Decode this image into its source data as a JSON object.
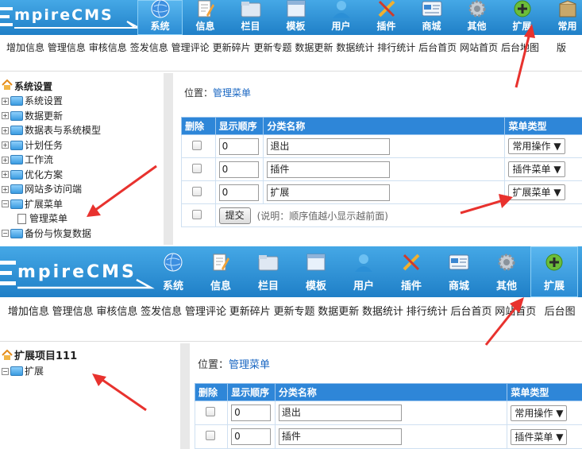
{
  "top": {
    "logo_text": "mpireCMS",
    "logo_letter": "E"
  },
  "shotA": {
    "menu": [
      {
        "label": "系统",
        "icon": "globe-icon",
        "active": true
      },
      {
        "label": "信息",
        "icon": "document-pencil-icon"
      },
      {
        "label": "栏目",
        "icon": "folder-icon"
      },
      {
        "label": "模板",
        "icon": "window-template-icon"
      },
      {
        "label": "用户",
        "icon": "user-icon"
      },
      {
        "label": "插件",
        "icon": "tools-icon"
      },
      {
        "label": "商城",
        "icon": "card-icon"
      },
      {
        "label": "其他",
        "icon": "gear-icon"
      },
      {
        "label": "扩展",
        "icon": "plus-circle-icon"
      },
      {
        "label": "常用",
        "icon": "box-icon"
      }
    ],
    "submenu": [
      "增加信息",
      "管理信息",
      "审核信息",
      "签发信息",
      "管理评论",
      "更新碎片",
      "更新专题",
      "数据更新",
      "数据统计",
      "排行统计",
      "后台首页",
      "网站首页",
      "后台地图",
      "版"
    ],
    "tree": {
      "root": "系统设置",
      "nodes": [
        "系统设置",
        "数据更新",
        "数据表与系统模型",
        "计划任务",
        "工作流",
        "优化方案",
        "网站多访问端",
        "扩展菜单"
      ],
      "child": "管理菜单",
      "after": "备份与恢复数据"
    },
    "location_prefix": "位置：",
    "location_link": "管理菜单",
    "table": {
      "headers": [
        "删除",
        "显示顺序",
        "分类名称",
        "菜单类型"
      ],
      "rows": [
        {
          "order": "0",
          "name": "退出",
          "type": "常用操作"
        },
        {
          "order": "0",
          "name": "插件",
          "type": "插件菜单"
        },
        {
          "order": "0",
          "name": "扩展",
          "type": "扩展菜单"
        }
      ],
      "submit": "提交",
      "note": "(说明：顺序值越小显示越前面)"
    }
  },
  "shotB": {
    "menu": [
      {
        "label": "系统",
        "icon": "globe-icon"
      },
      {
        "label": "信息",
        "icon": "document-pencil-icon"
      },
      {
        "label": "栏目",
        "icon": "folder-icon"
      },
      {
        "label": "模板",
        "icon": "window-template-icon"
      },
      {
        "label": "用户",
        "icon": "user-icon"
      },
      {
        "label": "插件",
        "icon": "tools-icon"
      },
      {
        "label": "商城",
        "icon": "card-icon"
      },
      {
        "label": "其他",
        "icon": "gear-icon"
      },
      {
        "label": "扩展",
        "icon": "plus-circle-icon",
        "active": true
      }
    ],
    "submenu": [
      "增加信息",
      "管理信息",
      "审核信息",
      "签发信息",
      "管理评论",
      "更新碎片",
      "更新专题",
      "数据更新",
      "数据统计",
      "排行统计",
      "后台首页",
      "网站首页",
      "后台图"
    ],
    "tree": {
      "root": "扩展项目111",
      "nodes": [
        "扩展"
      ]
    },
    "location_prefix": "位置：",
    "location_link": "管理菜单",
    "table": {
      "headers": [
        "删除",
        "显示顺序",
        "分类名称",
        "菜单类型"
      ],
      "rows": [
        {
          "order": "0",
          "name": "退出",
          "type": "常用操作"
        },
        {
          "order": "0",
          "name": "插件",
          "type": "插件菜单"
        }
      ]
    }
  },
  "colors": {
    "topbar": "#2b8fd6",
    "header": "#2e86d8",
    "arrow": "#e8322e",
    "link": "#1866c2"
  }
}
